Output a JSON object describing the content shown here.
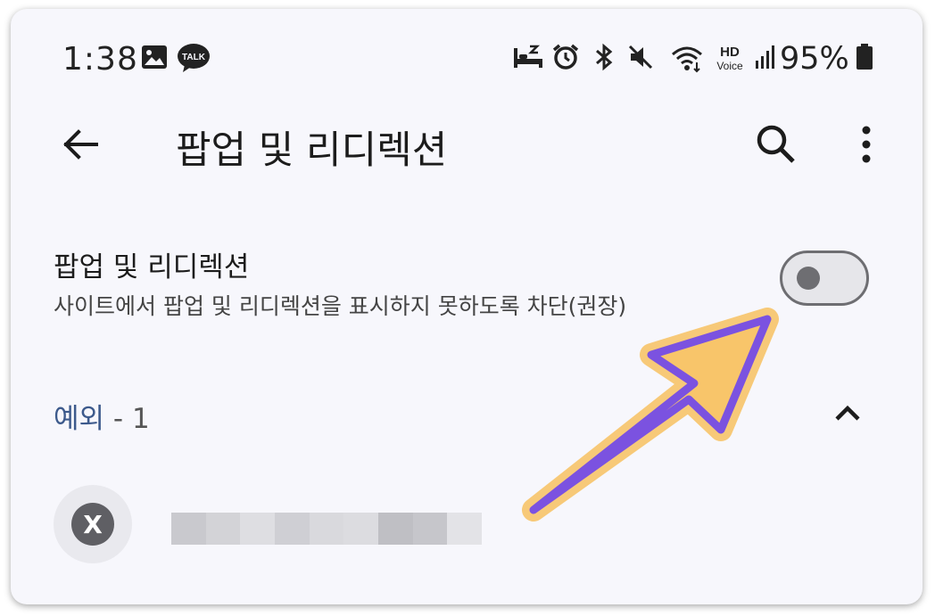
{
  "status_bar": {
    "time": "1:38",
    "battery": "95%",
    "hd_badge_top": "HD",
    "hd_badge_bottom": "Voice",
    "kakao_badge": "TALK",
    "icons": [
      "gallery-icon",
      "kakaotalk-icon",
      "sleep-icon",
      "alarm-icon",
      "bluetooth-icon",
      "mute-icon",
      "wifi-icon",
      "hd-voice-icon",
      "signal-icon",
      "battery-icon"
    ]
  },
  "app_bar": {
    "title": "팝업 및 리디렉션",
    "icons": [
      "back-arrow-icon",
      "search-icon",
      "more-vert-icon"
    ]
  },
  "setting": {
    "title": "팝업 및 리디렉션",
    "description": "사이트에서 팝업 및 리디렉션을 표시하지 못하도록 차단(권장)",
    "toggle_on": false
  },
  "exceptions": {
    "label": "예외",
    "count_text": " - 1",
    "expanded": true,
    "items": [
      {
        "avatar_letter": "X"
      }
    ]
  },
  "colors": {
    "background": "#f7f7fc",
    "accent_text": "#3d5a8c",
    "arrow_fill": "#7b52e0",
    "arrow_glow": "#f8c56a"
  }
}
